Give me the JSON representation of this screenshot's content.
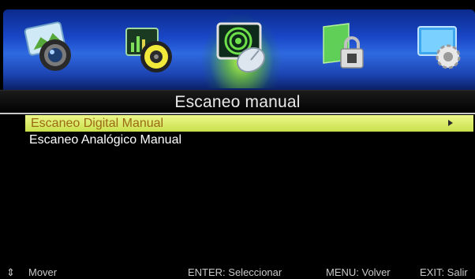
{
  "tabs": [
    {
      "name": "picture",
      "icon": "picture-camera-icon",
      "active": false
    },
    {
      "name": "sound",
      "icon": "sound-speaker-icon",
      "active": false
    },
    {
      "name": "channel",
      "icon": "satellite-dish-icon",
      "active": true
    },
    {
      "name": "lock",
      "icon": "lock-icon",
      "active": false
    },
    {
      "name": "setup",
      "icon": "gear-icon",
      "active": false
    }
  ],
  "menu": {
    "title": "Escaneo manual",
    "items": [
      {
        "label": "Escaneo Digital Manual",
        "selected": true
      },
      {
        "label": "Escaneo Analógico Manual",
        "selected": false
      }
    ]
  },
  "footer": {
    "move_icon_glyph": "⇕",
    "move": "Mover",
    "enter": "ENTER: Seleccionar",
    "menu": "MENU: Volver",
    "exit": "EXIT: Salir"
  },
  "colors": {
    "tabbar": "#1a47c8",
    "selection": "#d8ec60",
    "selection_text": "#9a6a14"
  }
}
